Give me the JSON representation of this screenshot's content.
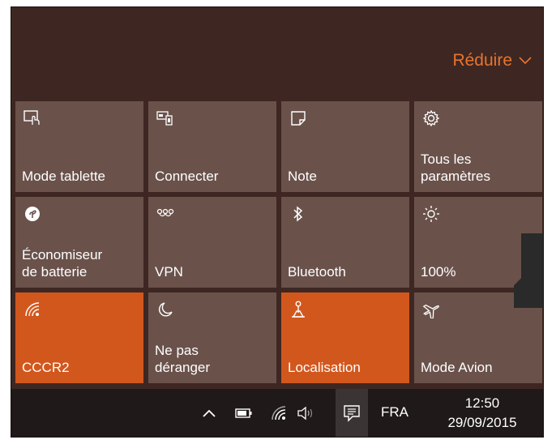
{
  "action_center": {
    "collapse_label": "Réduire",
    "tiles": [
      {
        "label": "Mode tablette",
        "icon": "tablet-mode-icon",
        "active": false
      },
      {
        "label": "Connecter",
        "icon": "connect-icon",
        "active": false
      },
      {
        "label": "Note",
        "icon": "note-icon",
        "active": false
      },
      {
        "label": "Tous les\nparamètres",
        "icon": "settings-icon",
        "active": false
      },
      {
        "label": "Économiseur\nde batterie",
        "icon": "battery-saver-icon",
        "active": false
      },
      {
        "label": "VPN",
        "icon": "vpn-icon",
        "active": false
      },
      {
        "label": "Bluetooth",
        "icon": "bluetooth-icon",
        "active": false
      },
      {
        "label": "100%",
        "icon": "brightness-icon",
        "active": false
      },
      {
        "label": "CCCR2",
        "icon": "wifi-icon",
        "active": true
      },
      {
        "label": "Ne pas\ndéranger",
        "icon": "moon-icon",
        "active": false
      },
      {
        "label": "Localisation",
        "icon": "location-icon",
        "active": true
      },
      {
        "label": "Mode Avion",
        "icon": "airplane-icon",
        "active": false
      }
    ]
  },
  "taskbar": {
    "language": "FRA",
    "time": "12:50",
    "date": "29/09/2015"
  },
  "colors": {
    "accent": "#d2571d",
    "tile": "#6a524b",
    "background": "#3e2722",
    "collapse_text": "#e8742f",
    "taskbar": "#1f1a19"
  }
}
